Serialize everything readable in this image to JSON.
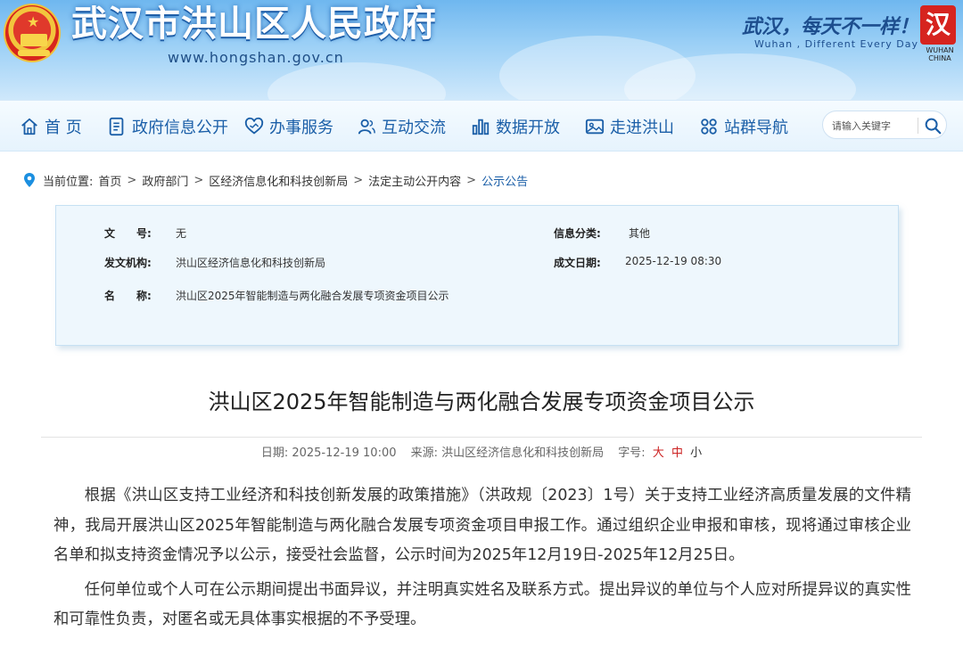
{
  "header": {
    "site_title": "武汉市洪山区人民政府",
    "site_url": "www.hongshan.gov.cn",
    "slogan": "武汉，每天不一样！",
    "slogan_en": "Wuhan , Different Every Day",
    "logo_char": "汉",
    "logo_caption": "WUHAN CHINA"
  },
  "nav": {
    "items": [
      {
        "label": "首 页",
        "icon": "home-icon"
      },
      {
        "label": "政府信息公开",
        "icon": "document-icon"
      },
      {
        "label": "办事服务",
        "icon": "handshake-icon"
      },
      {
        "label": "互动交流",
        "icon": "people-icon"
      },
      {
        "label": "数据开放",
        "icon": "bar-chart-icon"
      },
      {
        "label": "走进洪山",
        "icon": "photo-icon"
      },
      {
        "label": "站群导航",
        "icon": "grid-icon"
      }
    ],
    "search_placeholder": "请输入关键字"
  },
  "breadcrumb": {
    "prefix": "当前位置:",
    "items": [
      "首页",
      "政府部门",
      "区经济信息化和科技创新局",
      "法定主动公开内容",
      "公示公告"
    ],
    "separator": ">"
  },
  "info": {
    "doc_no_label": "文　　号:",
    "doc_no": "无",
    "category_label": "信息分类:",
    "category": "其他",
    "issuer_label": "发文机构:",
    "issuer": "洪山区经济信息化和科技创新局",
    "date_label": "成文日期:",
    "date": "2025-12-19 08:30",
    "name_label": "名　　称:",
    "name": "洪山区2025年智能制造与两化融合发展专项资金项目公示"
  },
  "article": {
    "title": "洪山区2025年智能制造与两化融合发展专项资金项目公示",
    "date_text": "日期: 2025-12-19 10:00",
    "source_text": "来源: 洪山区经济信息化和科技创新局",
    "font_label": "字号:",
    "size_big": "大",
    "size_mid": "中",
    "size_small": "小",
    "paragraphs": [
      "根据《洪山区支持工业经济和科技创新发展的政策措施》（洪政规〔2023〕1号）关于支持工业经济高质量发展的文件精神，我局开展洪山区2025年智能制造与两化融合发展专项资金项目申报工作。通过组织企业申报和审核，现将通过审核企业名单和拟支持资金情况予以公示，接受社会监督，公示时间为2025年12月19日-2025年12月25日。",
      "任何单位或个人可在公示期间提出书面异议，并注明真实姓名及联系方式。提出异议的单位与个人应对所提异议的真实性和可靠性负责，对匿名或无具体事实根据的不予受理。"
    ]
  },
  "colors": {
    "nav_text": "#1b5fa8",
    "header_sky": "#6fb7ef",
    "panel_bg": "#eef7fd",
    "accent_red": "#cc2222"
  }
}
